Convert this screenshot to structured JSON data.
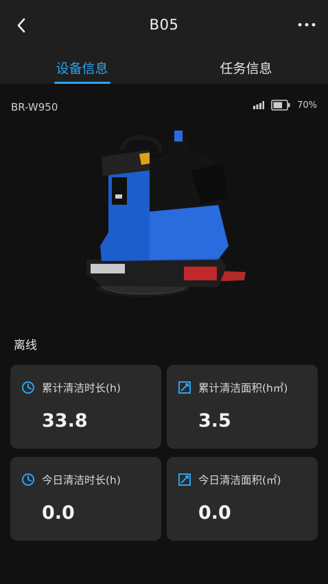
{
  "header": {
    "title": "B05",
    "back_icon": "chevron-left-icon",
    "more_icon": "more-horizontal-icon"
  },
  "tabs": [
    {
      "label": "设备信息",
      "active": true
    },
    {
      "label": "任务信息",
      "active": false
    }
  ],
  "device": {
    "model": "BR-W950",
    "signal_icon": "signal-bars-icon",
    "battery_icon": "battery-icon",
    "battery_text": "70%",
    "battery_level": 0.7,
    "status": "离线"
  },
  "stats": [
    {
      "icon": "clock-icon",
      "label": "累计清洁时长(h)",
      "value": "33.8"
    },
    {
      "icon": "area-icon",
      "label": "累计清洁面积(h㎡)",
      "value": "3.5"
    },
    {
      "icon": "clock-icon",
      "label": "今日清洁时长(h)",
      "value": "0.0"
    },
    {
      "icon": "area-icon",
      "label": "今日清洁面积(㎡)",
      "value": "0.0"
    }
  ],
  "colors": {
    "accent": "#2ea3f2",
    "background": "#111111",
    "card": "#2a2a2a",
    "header": "#1f1f1f"
  }
}
